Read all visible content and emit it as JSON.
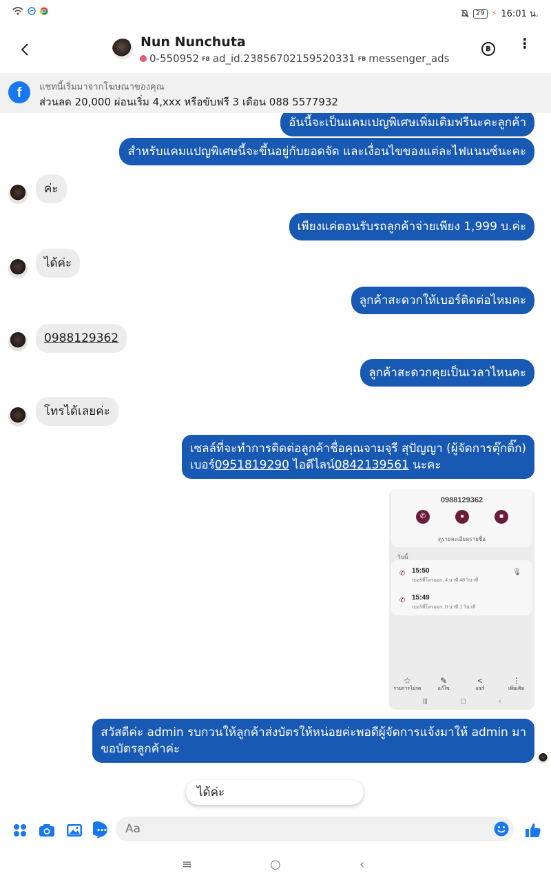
{
  "status_bar": {
    "time": "16:01 น.",
    "battery": "29"
  },
  "header": {
    "name": "Nun Nunchuta",
    "phone": "0-550952",
    "ad_id": "ad_id.23856702159520331",
    "source": "messenger_ads",
    "fb_tag": "FB"
  },
  "ad_banner": {
    "line1": "แชทนี้เริ่มมาจากโฆษณาของคุณ",
    "line2": "ส่วนลด 20,000 ผ่อนเริ่ม 4,xxx หรือขับฟรี 3 เดือน 088 5577932"
  },
  "messages": [
    {
      "dir": "out",
      "text": "อันนี้จะเป็นแคมเปญพิเศษเพิ่มเติมฟรีนะคะลูกค้า"
    },
    {
      "dir": "out",
      "text": "สำหรับแคมแปญพิเศษนี้จะขึ้นอยู่กับยอดจัด และเงื่อนไขของแต่ละไฟแนนซ์นะคะ"
    },
    {
      "dir": "in",
      "text": "ค่ะ"
    },
    {
      "dir": "out",
      "text": "เพียงแค่ตอนรับรถลูกค้าจ่ายเพียง 1,999 บ.ค่ะ"
    },
    {
      "dir": "in",
      "text": "ได้ค่ะ"
    },
    {
      "dir": "out",
      "text": "ลูกค้าสะดวกให้เบอร์ติดต่อไหมคะ"
    },
    {
      "dir": "in",
      "text": "0988129362"
    },
    {
      "dir": "out",
      "text": "ลูกค้าสะดวกคุยเป็นเวลาไหนคะ"
    },
    {
      "dir": "in",
      "text": "โทรได้เลยค่ะ"
    },
    {
      "dir": "out",
      "line1": "เซลล์ที่จะทำการติดต่อลูกค้าชื่อคุณจามจุรี สุปัญญา (ผู้จัดการตุ๊กติ๊ก)",
      "l2a": "เบอร์",
      "l2b": "0951819290",
      "l2c": " ไอดีไลน์",
      "l2d": "0842139561",
      "l2e": " นะคะ"
    },
    {
      "dir": "out",
      "line1": "สวัสดีค่ะ admin รบกวนให้ลูกค้าส่งบัตรให้หน่อยค่ะพอดีผู้จัดการแจ้งมาให้ admin มา",
      "line2": "ขอบัตรลูกค้าค่ะ"
    }
  ],
  "attachment": {
    "number": "0988129362",
    "add_contact": "ดูรายละเอียดรายชื่อ",
    "today": "วันนี้",
    "calls": [
      {
        "time": "15:50",
        "desc": "เบอร์ที่โทรออก, 4 นาที 48 วินาที"
      },
      {
        "time": "15:49",
        "desc": "เบอร์ที่โทรออก, 0 นาที 1 วินาที"
      }
    ],
    "actions": [
      "รายการโปรด",
      "แก้ไข",
      "แชร์",
      "เพิ่มเติม"
    ]
  },
  "quick_reply": "ได้ค่ะ",
  "composer": {
    "placeholder": "Aa"
  },
  "colors": {
    "outgoing": "#1859b3",
    "incoming": "#ececec",
    "accent": "#1877f2"
  }
}
